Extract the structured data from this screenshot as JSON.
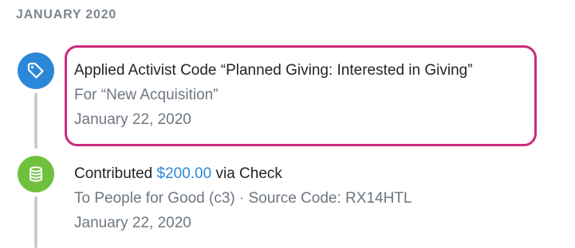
{
  "timeline": {
    "month_header": "JANUARY 2020",
    "colors": {
      "tag_icon_bg": "#2b88d9",
      "money_icon_bg": "#6fc13d",
      "highlight_border": "#cc2a7a",
      "link": "#2b88d9"
    },
    "entries": [
      {
        "icon": "tag-icon",
        "title": "Applied Activist Code “Planned Giving: Interested in Giving”",
        "subtitle": "For “New Acquisition”",
        "date": "January 22, 2020"
      },
      {
        "icon": "coins-icon",
        "title_prefix": "Contributed ",
        "amount": "$200.00",
        "title_suffix": " via Check",
        "subtitle": "To People for Good (c3) · Source Code: RX14HTL",
        "date": "January 22, 2020"
      }
    ]
  }
}
